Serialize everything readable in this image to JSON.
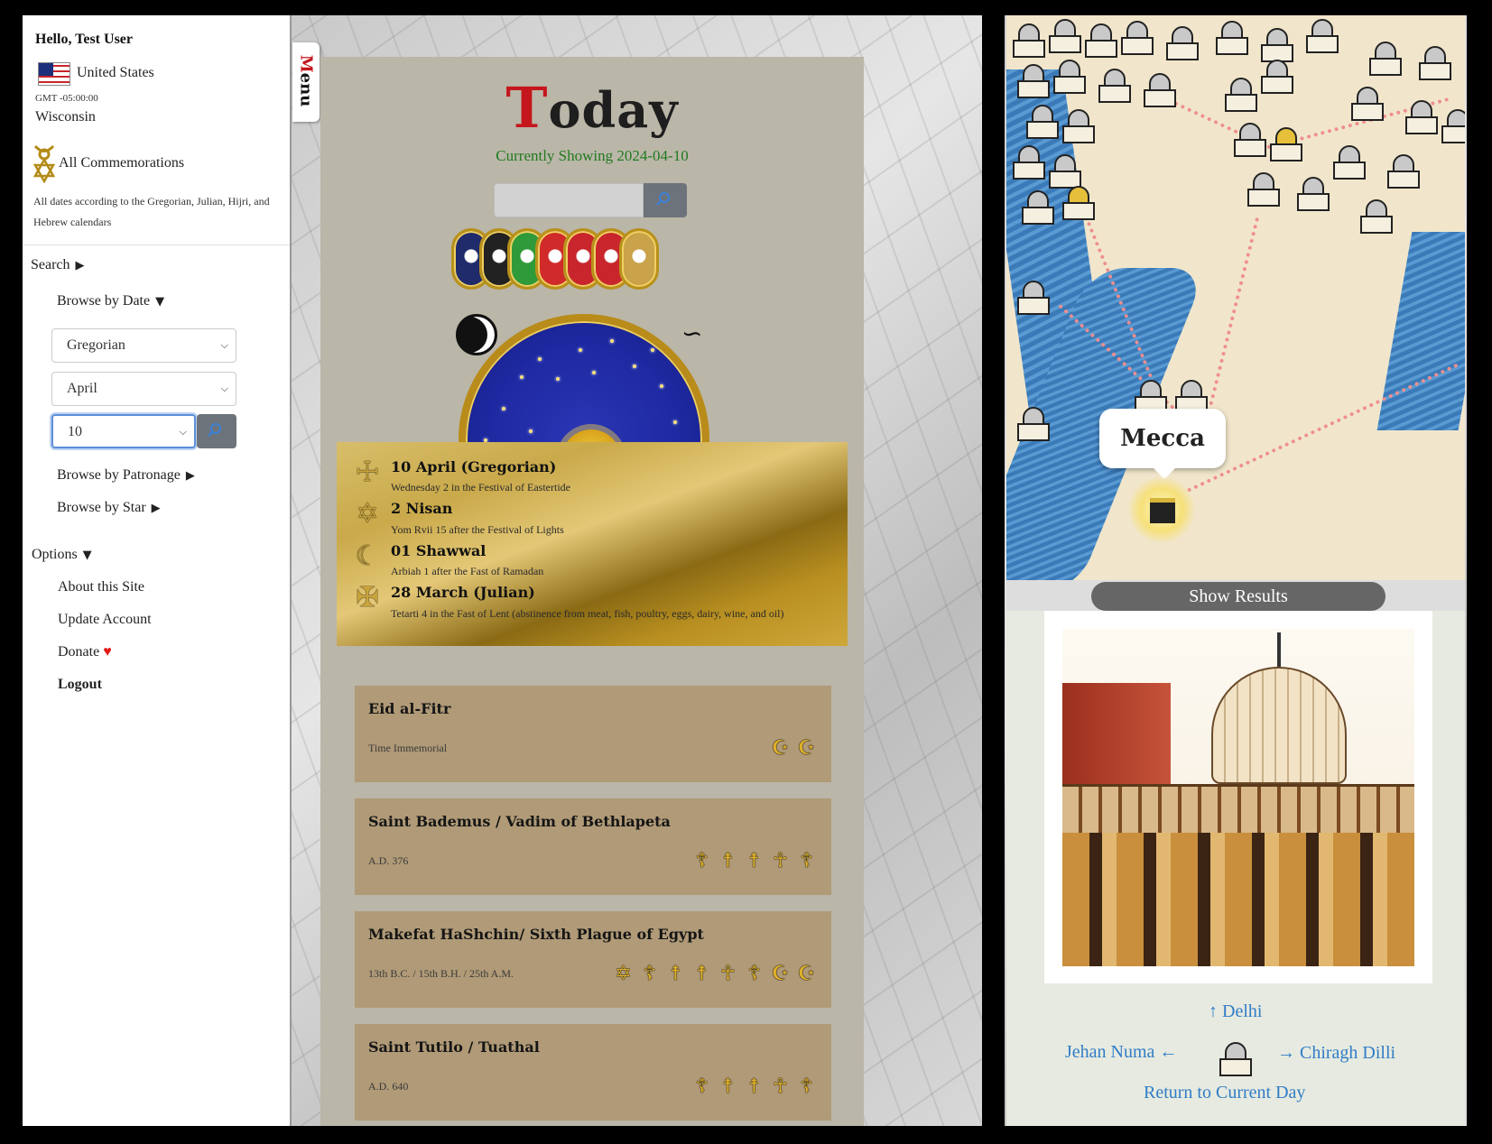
{
  "sidebar": {
    "greeting": "Hello, Test User",
    "country": "United States",
    "timezone": "GMT -05:00:00",
    "state": "Wisconsin",
    "commemorations": "All Commemorations",
    "calendar_note": "All dates according to the Gregorian, Julian, Hijri, and Hebrew calendars",
    "search_label": "Search",
    "browse_date": "Browse by Date",
    "calendar_select": "Gregorian",
    "month_select": "April",
    "day_select": "10",
    "browse_patronage": "Browse by Patronage",
    "browse_star": "Browse by Star",
    "options_label": "Options",
    "about": "About this Site",
    "update": "Update Account",
    "donate": "Donate",
    "heart": "♥",
    "logout": "Logout",
    "triangle_right": "▶",
    "triangle_down": "▼"
  },
  "menu_tab": {
    "first": "M",
    "rest": "enu"
  },
  "main": {
    "title_first": "T",
    "title_rest": "oday",
    "currently_showing": "Currently Showing 2024-04-10",
    "search_placeholder": "",
    "zodiac_glyph": "♈",
    "tilde_glyph": "∽",
    "medal_colors": [
      "#1f2b6b",
      "#222",
      "#2f9a3a",
      "#d02a2a",
      "#c8262c",
      "#c8262c",
      "#c9a24a"
    ],
    "dates": [
      {
        "icon": "☩",
        "title": "10 April (Gregorian)",
        "sub": "Wednesday 2 in the Festival of Eastertide"
      },
      {
        "icon": "✡",
        "title": "2 Nisan",
        "sub": "Yom Rvii 15 after the Festival of Lights"
      },
      {
        "icon": "☾",
        "title": "01 Shawwal",
        "sub": "Arbiah 1 after the Fast of Ramadan"
      },
      {
        "icon": "✠",
        "title": "28 March (Julian)",
        "sub": "Tetarti 4 in the Fast of Lent (abstinence from meat, fish, poultry, eggs, dairy, wine, and oil)"
      }
    ],
    "cards": [
      {
        "title": "Eid al-Fitr",
        "date": "Time Immemorial",
        "symbols": [
          "☪",
          "☪"
        ]
      },
      {
        "title": "Saint Bademus / Vadim of Bethlapeta",
        "date": "A.D. 376",
        "symbols": [
          "☦",
          "☨",
          "☨",
          "☥",
          "☦"
        ]
      },
      {
        "title": "Makefat HaShchin/ Sixth Plague of Egypt",
        "date": "13th B.C. / 15th B.H. / 25th A.M.",
        "symbols": [
          "✡",
          "☦",
          "☨",
          "☨",
          "☥",
          "☦",
          "☪",
          "☪"
        ]
      },
      {
        "title": "Saint Tutilo / Tuathal",
        "date": "A.D. 640",
        "symbols": [
          "☦",
          "☨",
          "☨",
          "☥",
          "☦"
        ]
      }
    ]
  },
  "map": {
    "location_label": "Mecca",
    "show_results": "Show Results"
  },
  "info": {
    "north_link": "↑ Delhi",
    "west_link": "Jehan Numa ←",
    "east_link": "→ Chiragh Dilli",
    "return_link": "Return to Current Day"
  }
}
